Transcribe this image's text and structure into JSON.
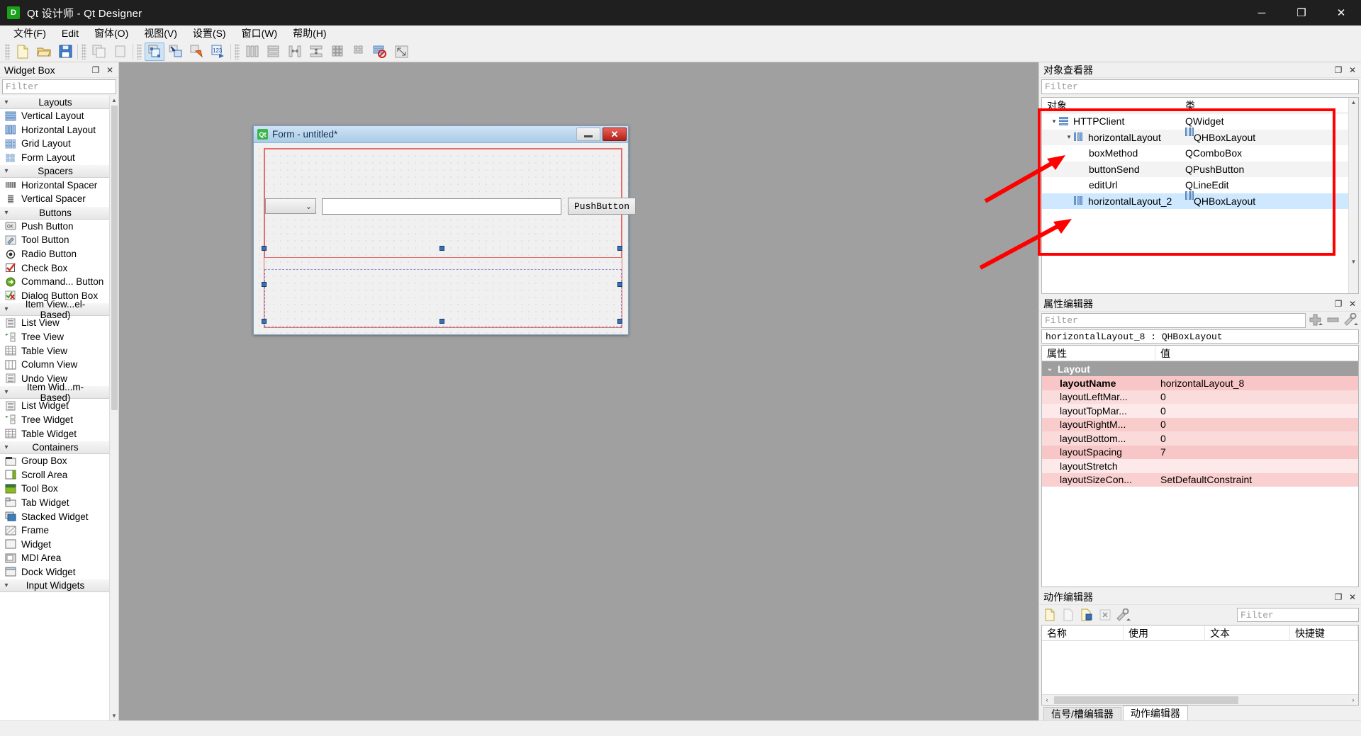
{
  "window": {
    "app_icon": "D",
    "title": "Qt 设计师 - Qt Designer",
    "minimize": "─",
    "maximize": "❐",
    "close": "✕"
  },
  "menubar": {
    "items": [
      {
        "label": "文件(F)"
      },
      {
        "label": "Edit"
      },
      {
        "label": "窗体(O)"
      },
      {
        "label": "视图(V)"
      },
      {
        "label": "设置(S)"
      },
      {
        "label": "窗口(W)"
      },
      {
        "label": "帮助(H)"
      }
    ]
  },
  "toolbar": {
    "groups": [
      [
        "new-file-icon",
        "open-folder-icon",
        "save-icon"
      ],
      [
        "copy-icon",
        "paste-icon"
      ],
      [
        "edit-widgets-icon",
        "edit-signals-icon",
        "edit-buddies-icon",
        "edit-tab-order-icon"
      ],
      [
        "layout-horizontal-icon",
        "layout-vertical-icon",
        "layout-splitter-h-icon",
        "layout-splitter-v-icon",
        "layout-grid-icon",
        "layout-form-icon",
        "break-layout-icon",
        "adjust-size-icon"
      ]
    ]
  },
  "widget_box": {
    "title": "Widget Box",
    "filter_placeholder": "Filter",
    "float_btn": "❐",
    "close_btn": "✕",
    "categories": [
      {
        "name": "Layouts",
        "items": [
          {
            "label": "Vertical Layout",
            "icon": "vertical-layout-icon"
          },
          {
            "label": "Horizontal Layout",
            "icon": "horizontal-layout-icon"
          },
          {
            "label": "Grid Layout",
            "icon": "grid-layout-icon"
          },
          {
            "label": "Form Layout",
            "icon": "form-layout-icon"
          }
        ]
      },
      {
        "name": "Spacers",
        "items": [
          {
            "label": "Horizontal Spacer",
            "icon": "horizontal-spacer-icon"
          },
          {
            "label": "Vertical Spacer",
            "icon": "vertical-spacer-icon"
          }
        ]
      },
      {
        "name": "Buttons",
        "items": [
          {
            "label": "Push Button",
            "icon": "push-button-icon"
          },
          {
            "label": "Tool Button",
            "icon": "tool-button-icon"
          },
          {
            "label": "Radio Button",
            "icon": "radio-button-icon"
          },
          {
            "label": "Check Box",
            "icon": "check-box-icon"
          },
          {
            "label": "Command... Button",
            "icon": "command-link-button-icon"
          },
          {
            "label": "Dialog Button Box",
            "icon": "dialog-button-box-icon"
          }
        ]
      },
      {
        "name": "Item View...el-Based)",
        "items": [
          {
            "label": "List View",
            "icon": "list-view-icon"
          },
          {
            "label": "Tree View",
            "icon": "tree-view-icon"
          },
          {
            "label": "Table View",
            "icon": "table-view-icon"
          },
          {
            "label": "Column View",
            "icon": "column-view-icon"
          },
          {
            "label": "Undo View",
            "icon": "undo-view-icon"
          }
        ]
      },
      {
        "name": "Item Wid...m-Based)",
        "items": [
          {
            "label": "List Widget",
            "icon": "list-widget-icon"
          },
          {
            "label": "Tree Widget",
            "icon": "tree-widget-icon"
          },
          {
            "label": "Table Widget",
            "icon": "table-widget-icon"
          }
        ]
      },
      {
        "name": "Containers",
        "items": [
          {
            "label": "Group Box",
            "icon": "group-box-icon"
          },
          {
            "label": "Scroll Area",
            "icon": "scroll-area-icon"
          },
          {
            "label": "Tool Box",
            "icon": "tool-box-icon"
          },
          {
            "label": "Tab Widget",
            "icon": "tab-widget-icon"
          },
          {
            "label": "Stacked Widget",
            "icon": "stacked-widget-icon"
          },
          {
            "label": "Frame",
            "icon": "frame-icon"
          },
          {
            "label": "Widget",
            "icon": "widget-icon"
          },
          {
            "label": "MDI Area",
            "icon": "mdi-area-icon"
          },
          {
            "label": "Dock Widget",
            "icon": "dock-widget-icon"
          }
        ]
      },
      {
        "name": "Input Widgets",
        "items": []
      }
    ]
  },
  "form": {
    "badge": "Qt",
    "title": "Form - untitled*",
    "minimize": "─",
    "close": "✕",
    "combo_arrow": "⌄",
    "push_button_label": "PushButton"
  },
  "object_inspector": {
    "title": "对象查看器",
    "float_btn": "❐",
    "close_btn": "✕",
    "filter_placeholder": "Filter",
    "columns": [
      "对象",
      "类"
    ],
    "rows": [
      {
        "name": "HTTPClient",
        "cls": "QWidget",
        "depth": 0,
        "chevron": "⌄",
        "icon": "widget-icon",
        "selected": false
      },
      {
        "name": "horizontalLayout",
        "cls": "QHBoxLayout",
        "depth": 1,
        "chevron": "⌄",
        "icon": "hbox-layout-icon",
        "selected": false
      },
      {
        "name": "boxMethod",
        "cls": "QComboBox",
        "depth": 2,
        "chevron": "",
        "icon": "",
        "selected": false
      },
      {
        "name": "buttonSend",
        "cls": "QPushButton",
        "depth": 2,
        "chevron": "",
        "icon": "",
        "selected": false
      },
      {
        "name": "editUrl",
        "cls": "QLineEdit",
        "depth": 2,
        "chevron": "",
        "icon": "",
        "selected": false
      },
      {
        "name": "horizontalLayout_2",
        "cls": "QHBoxLayout",
        "depth": 1,
        "chevron": "",
        "icon": "hbox-layout-icon",
        "selected": true
      }
    ]
  },
  "property_editor": {
    "title": "属性编辑器",
    "float_btn": "❐",
    "close_btn": "✕",
    "filter_placeholder": "Filter",
    "add_btn": "add-property-icon",
    "remove_btn": "remove-property-icon",
    "config_btn": "configure-icon",
    "object_line": "horizontalLayout_8 : QHBoxLayout",
    "columns": [
      "属性",
      "值"
    ],
    "group": {
      "label": "Layout",
      "chevron": "⌄"
    },
    "rows": [
      {
        "key": "layoutName",
        "value": "horizontalLayout_8",
        "bold": true
      },
      {
        "key": "layoutLeftMar...",
        "value": "0",
        "bold": false
      },
      {
        "key": "layoutTopMar...",
        "value": "0",
        "bold": false
      },
      {
        "key": "layoutRightM...",
        "value": "0",
        "bold": false
      },
      {
        "key": "layoutBottom...",
        "value": "0",
        "bold": false
      },
      {
        "key": "layoutSpacing",
        "value": "7",
        "bold": false
      },
      {
        "key": "layoutStretch",
        "value": "",
        "bold": false
      },
      {
        "key": "layoutSizeCon...",
        "value": "SetDefaultConstraint",
        "bold": false
      }
    ]
  },
  "action_editor": {
    "title": "动作编辑器",
    "float_btn": "❐",
    "close_btn": "✕",
    "filter_placeholder": "Filter",
    "tool_icons": [
      "new-action-icon",
      "copy-action-icon",
      "paste-action-icon",
      "delete-action-icon",
      "configure-action-icon"
    ],
    "columns": [
      "名称",
      "使用",
      "文本",
      "快捷键"
    ],
    "rows": [],
    "scroll_left": "‹",
    "scroll_right": "›",
    "tabs": [
      {
        "label": "信号/槽编辑器",
        "selected": false
      },
      {
        "label": "动作编辑器",
        "selected": true
      }
    ]
  },
  "annotations": {
    "highlight_color": "#ff0000",
    "arrow_color": "#ff0000"
  }
}
